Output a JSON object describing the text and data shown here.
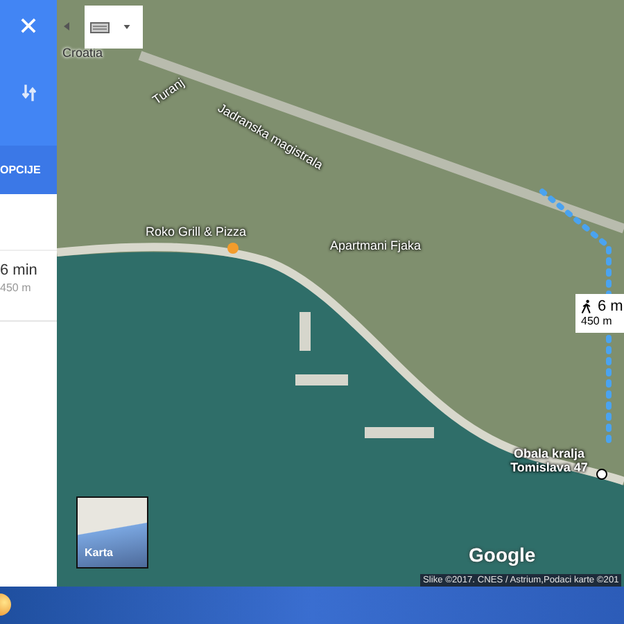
{
  "sidebar": {
    "options_button": "OPCIJE",
    "route": {
      "duration": "6 min",
      "distance": "450 m"
    }
  },
  "map": {
    "labels": [
      {
        "kind": "region",
        "text": "Croatia"
      },
      {
        "kind": "road",
        "text": "Turanj"
      },
      {
        "kind": "road",
        "text": "Jadranska magistrala"
      },
      {
        "kind": "poi",
        "text": "Roko Grill & Pizza"
      },
      {
        "kind": "poi",
        "text": "Apartmani Fjaka"
      },
      {
        "kind": "destination",
        "text": "Obala kralja Tomislava 47"
      }
    ],
    "route_bubble": {
      "duration": "6 m",
      "distance": "450 m"
    },
    "minimap_label": "Karta",
    "logo": "Google",
    "attribution": "Slike ©2017. CNES / Astrium,Podaci karte ©201"
  }
}
